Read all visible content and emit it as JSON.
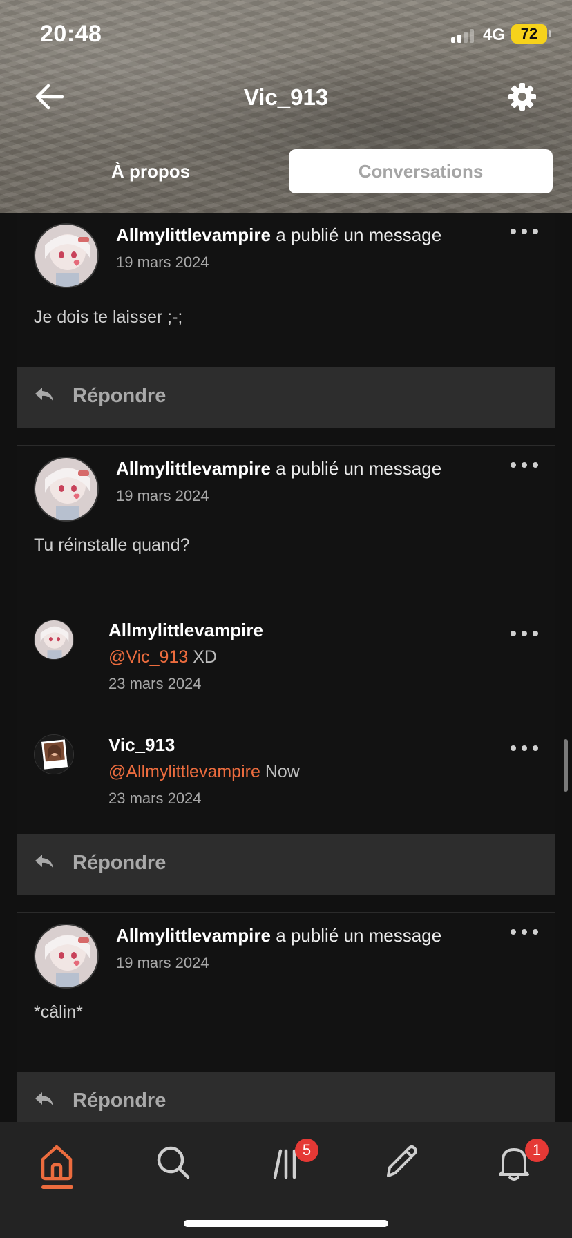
{
  "status_bar": {
    "time": "20:48",
    "network": "4G",
    "battery": "72"
  },
  "header": {
    "title": "Vic_913"
  },
  "tabs": {
    "about": "À propos",
    "conversations": "Conversations"
  },
  "posts": [
    {
      "author": "Allmylittlevampire",
      "action": " a publié un message",
      "date": "19 mars 2024",
      "message": "Je dois te laisser ;-;",
      "reply_label": "Répondre"
    },
    {
      "author": "Allmylittlevampire",
      "action": " a publié un message",
      "date": "19 mars 2024",
      "message": "Tu réinstalle quand?",
      "comments": [
        {
          "author": "Allmylittlevampire",
          "mention": "@Vic_913",
          "text": " XD",
          "date": "23 mars 2024"
        },
        {
          "author": "Vic_913",
          "mention": "@Allmylittlevampire",
          "text": " Now",
          "date": "23 mars 2024"
        }
      ],
      "reply_label": "Répondre"
    },
    {
      "author": "Allmylittlevampire",
      "action": " a publié un message",
      "date": "19 mars 2024",
      "message": "*câlin*",
      "reply_label": "Répondre"
    }
  ],
  "tabbar": {
    "library_badge": "5",
    "notifications_badge": "1"
  },
  "colors": {
    "accent": "#ec6c3e",
    "badge": "#e53935",
    "background": "#111111"
  }
}
